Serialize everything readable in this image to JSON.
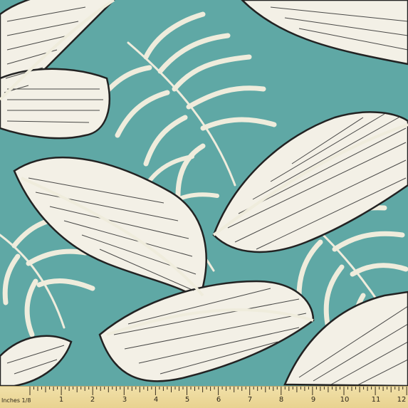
{
  "image": {
    "subject": "fabric-swatch",
    "colors": {
      "background_teal": "#5fa8a5",
      "leaf_cream": "#f3f0e6",
      "leaf_outline": "#222222",
      "frond_cream": "#efecdc",
      "ruler_yellow": "#ecd99a"
    }
  },
  "ruler": {
    "unit_label": "Inches 1/8",
    "numbers": [
      "1",
      "2",
      "3",
      "4",
      "5",
      "6",
      "7",
      "8",
      "9",
      "10",
      "11",
      "12",
      "1"
    ]
  }
}
